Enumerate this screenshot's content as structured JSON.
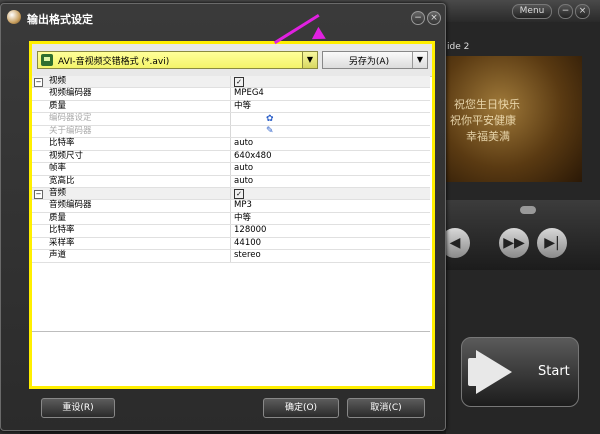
{
  "app": {
    "menu_label": "Menu",
    "slide_label": "ide 2",
    "start_label": "Start",
    "preview_lines": [
      "祝您生日快乐",
      "祝你平安健康",
      "幸福美满"
    ]
  },
  "dialog": {
    "title": "输出格式设定",
    "format": "AVI-音视频交错格式 (*.avi)",
    "save_as": "另存为(A)",
    "reset": "重设(R)",
    "ok": "确定(O)",
    "cancel": "取消(C)"
  },
  "settings": [
    {
      "type": "group",
      "label": "视频",
      "value": "✓",
      "checkbox": true
    },
    {
      "type": "item",
      "label": "视频编码器",
      "value": "MPEG4"
    },
    {
      "type": "item",
      "label": "质量",
      "value": "中等"
    },
    {
      "type": "item",
      "label": "编码器设定",
      "value": "",
      "disabled": true,
      "icon": "gear-icon"
    },
    {
      "type": "item",
      "label": "关于编码器",
      "value": "",
      "disabled": true,
      "icon": "edit-icon"
    },
    {
      "type": "item",
      "label": "比特率",
      "value": "auto"
    },
    {
      "type": "item",
      "label": "视频尺寸",
      "value": "640x480"
    },
    {
      "type": "item",
      "label": "帧率",
      "value": "auto"
    },
    {
      "type": "item",
      "label": "宽高比",
      "value": "auto"
    },
    {
      "type": "group",
      "label": "音频",
      "value": "✓",
      "checkbox": true
    },
    {
      "type": "item",
      "label": "音频编码器",
      "value": "MP3"
    },
    {
      "type": "item",
      "label": "质量",
      "value": "中等"
    },
    {
      "type": "item",
      "label": "比特率",
      "value": "128000"
    },
    {
      "type": "item",
      "label": "采样率",
      "value": "44100"
    },
    {
      "type": "item",
      "label": "声道",
      "value": "stereo"
    }
  ],
  "colors": {
    "highlight": "#ffef00",
    "annotation_arrow": "#e020e0"
  }
}
